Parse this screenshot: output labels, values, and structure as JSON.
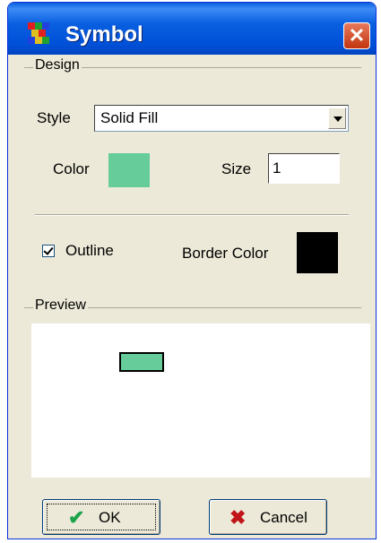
{
  "window": {
    "title": "Symbol",
    "close_glyph": "✕"
  },
  "design": {
    "group_title": "Design",
    "style_label": "Style",
    "style_value": "Solid Fill",
    "color_label": "Color",
    "fill_color": "#66cc99",
    "size_label": "Size",
    "size_value": "1",
    "outline_label": "Outline",
    "outline_checked": true,
    "border_color_label": "Border Color",
    "border_color": "#000000"
  },
  "preview": {
    "group_title": "Preview"
  },
  "buttons": {
    "ok_label": "OK",
    "ok_icon": "checkmark-icon",
    "cancel_label": "Cancel",
    "cancel_icon": "x-icon"
  },
  "colors": {
    "title_bar": "#0a5fe0",
    "dialog_bg": "#ece9d8",
    "ok_icon": "#1aa34a",
    "cancel_icon": "#c0161a"
  }
}
